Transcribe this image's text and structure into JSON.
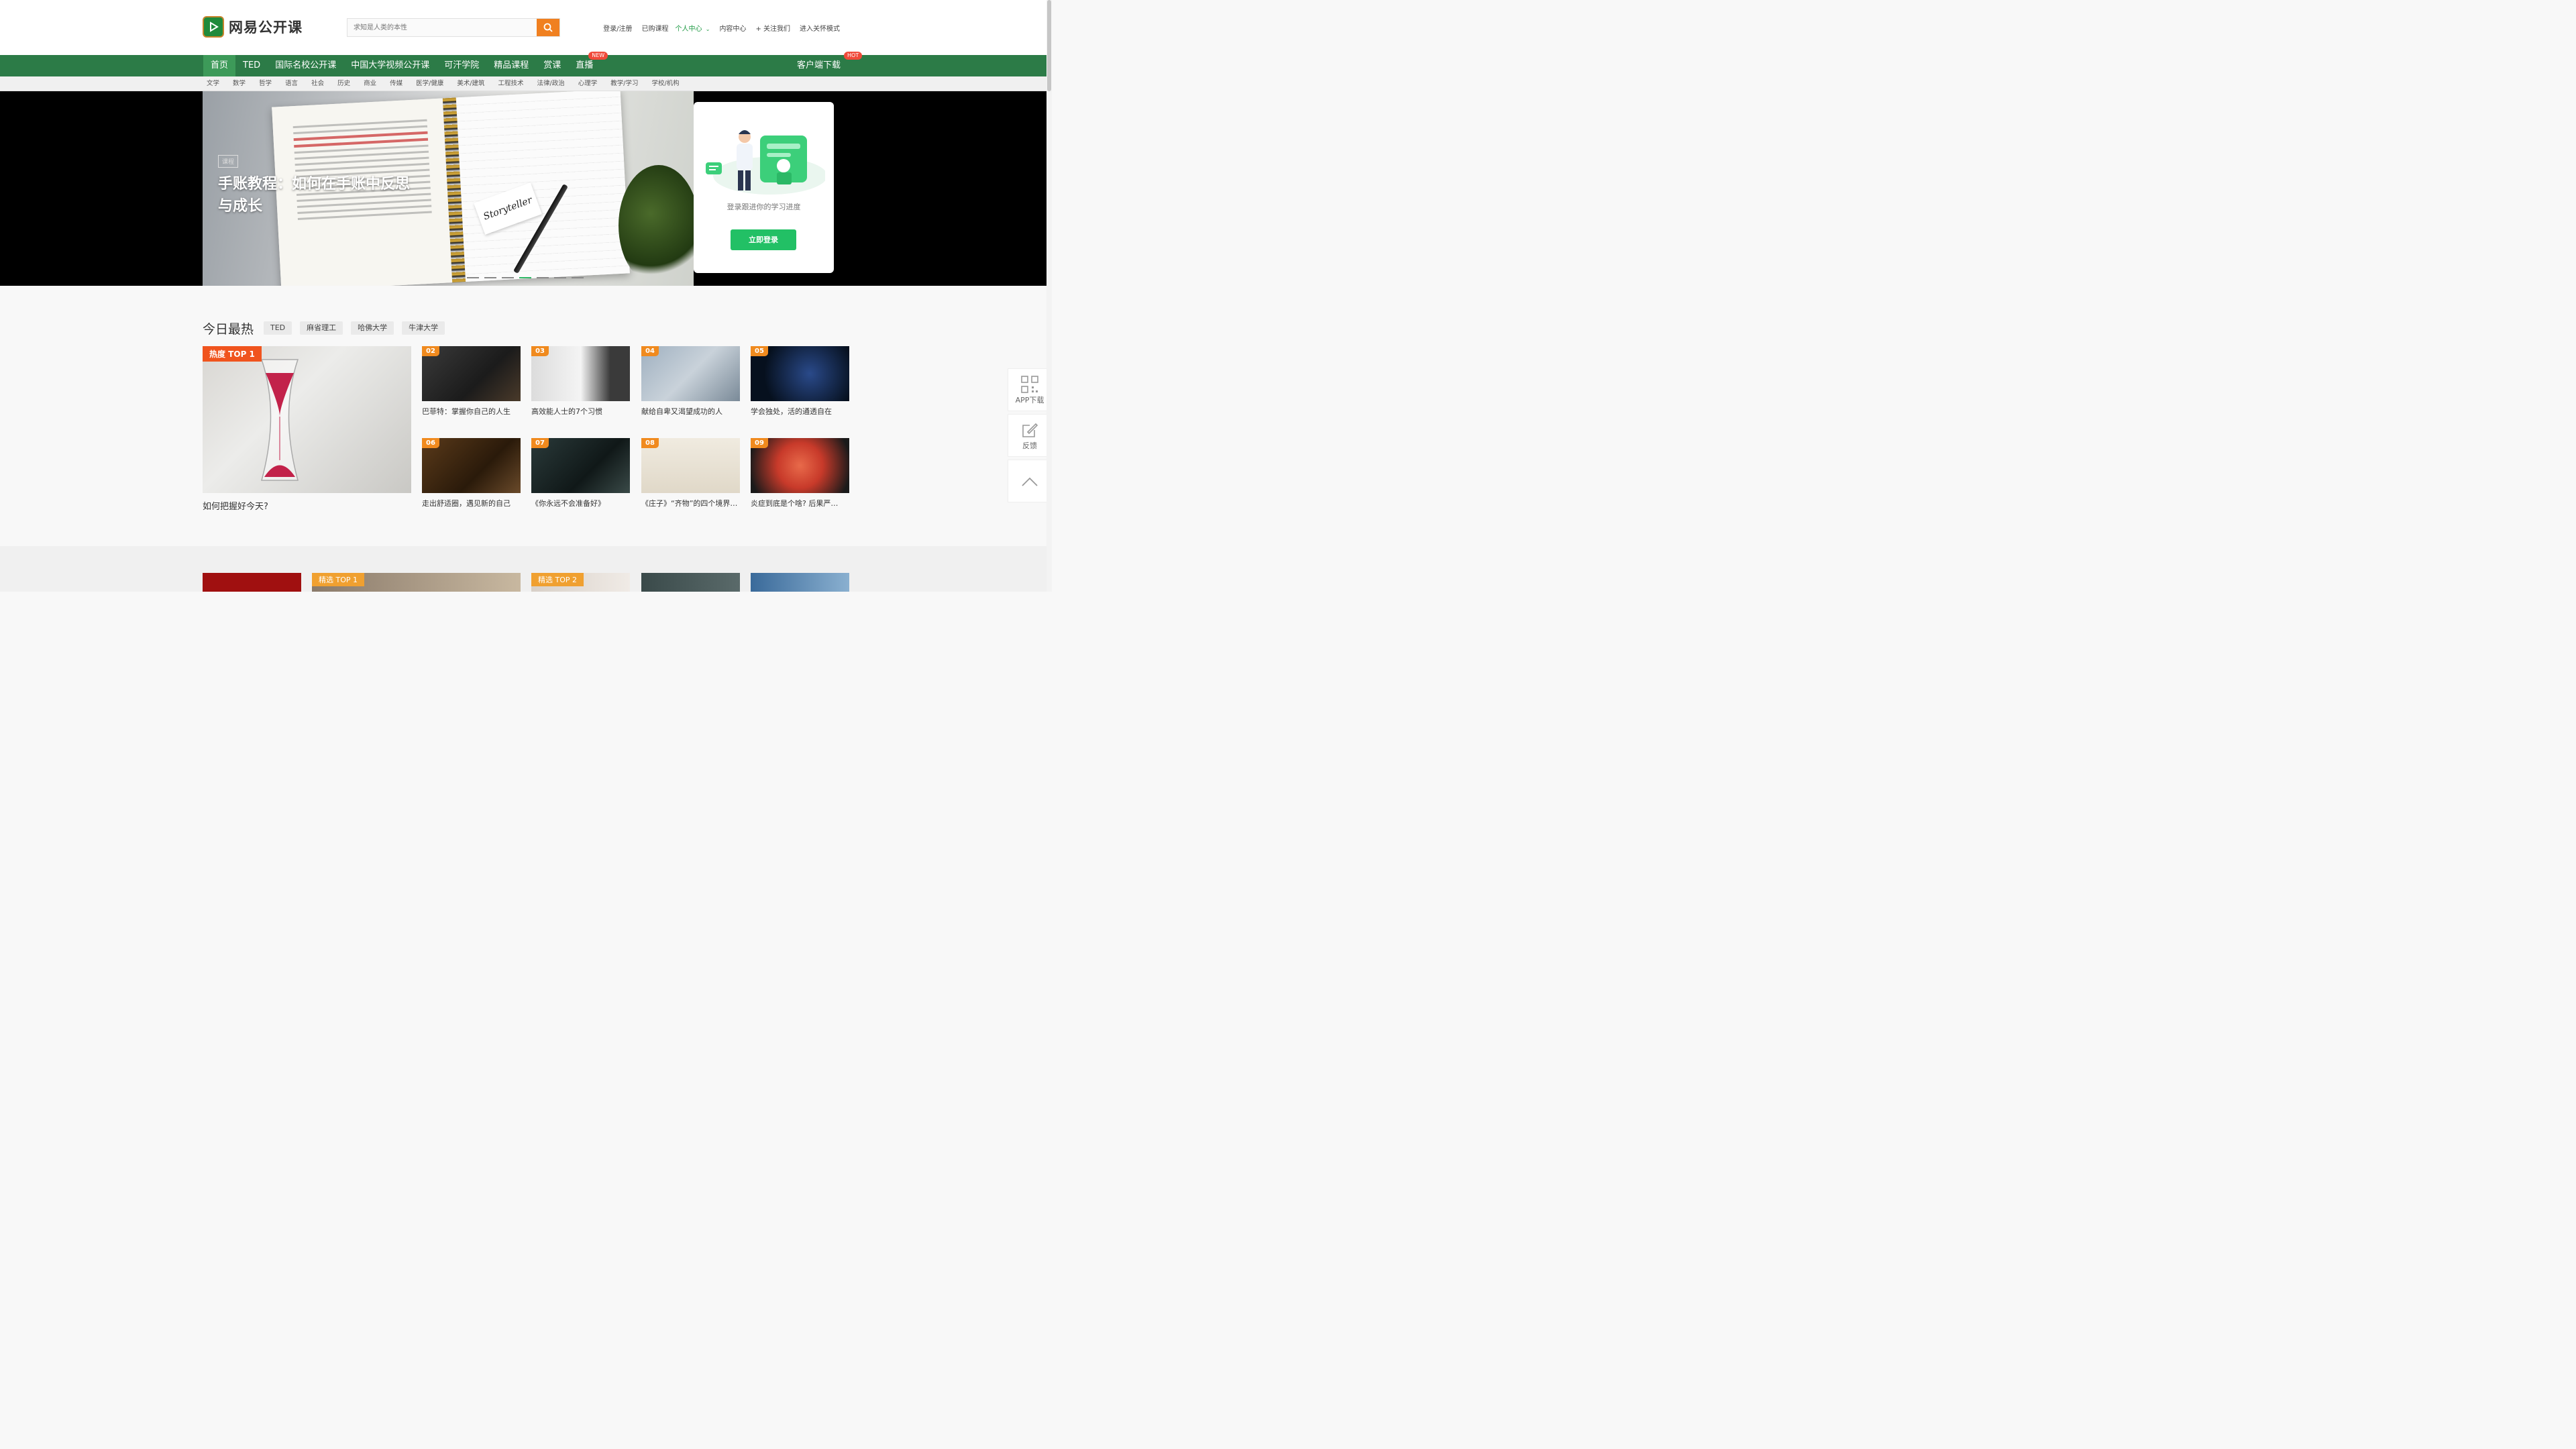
{
  "header": {
    "logo_text": "网易公开课",
    "search_placeholder": "求知是人类的本性",
    "links": {
      "login": "登录/注册",
      "purchased": "已购课程",
      "personal": "个人中心",
      "content": "内容中心",
      "follow": "+ 关注我们",
      "care_mode": "进入关怀模式"
    }
  },
  "nav": {
    "items": [
      "首页",
      "TED",
      "国际名校公开课",
      "中国大学视频公开课",
      "可汗学院",
      "精品课程",
      "赏课",
      "直播"
    ],
    "live_badge": "NEW",
    "download": "客户端下载",
    "download_badge": "HOT"
  },
  "subnav": [
    "文学",
    "数学",
    "哲学",
    "语言",
    "社会",
    "历史",
    "商业",
    "传媒",
    "医学/健康",
    "美术/建筑",
    "工程技术",
    "法律/政治",
    "心理学",
    "教学/学习",
    "学校/机构"
  ],
  "banner": {
    "tag": "课程",
    "title": "手账教程：如何在手账中反思与成长",
    "card_word": "Storyteller",
    "active_dot": 3,
    "dot_count": 7
  },
  "login_card": {
    "text": "登录跟进你的学习进度",
    "button": "立即登录"
  },
  "hot": {
    "title": "今日最热",
    "tags": [
      "TED",
      "麻省理工",
      "哈佛大学",
      "牛津大学"
    ],
    "top": {
      "rank": "热度 TOP 1",
      "caption": "如何把握好今天?"
    },
    "items": [
      {
        "rank": "02",
        "caption": "巴菲特：掌握你自己的人生"
      },
      {
        "rank": "03",
        "caption": "高效能人士的7个习惯"
      },
      {
        "rank": "04",
        "caption": "献给自卑又渴望成功的人"
      },
      {
        "rank": "05",
        "caption": "学会独处，活的通透自在"
      },
      {
        "rank": "06",
        "caption": "走出舒适圈，遇见新的自己"
      },
      {
        "rank": "07",
        "caption": "《你永远不会准备好》"
      },
      {
        "rank": "08",
        "caption": "《庄子》“齐物”的四个境界…"
      },
      {
        "rank": "09",
        "caption": "炎症到底是个啥? 后果严…"
      }
    ]
  },
  "featured": {
    "tag1": "精选 TOP 1",
    "tag2": "精选 TOP 2"
  },
  "side": {
    "app": "APP下载",
    "feedback": "反馈"
  },
  "colors": {
    "nav_green": "#2c7b47",
    "accent_orange": "#f08020",
    "login_green": "#22c065"
  }
}
